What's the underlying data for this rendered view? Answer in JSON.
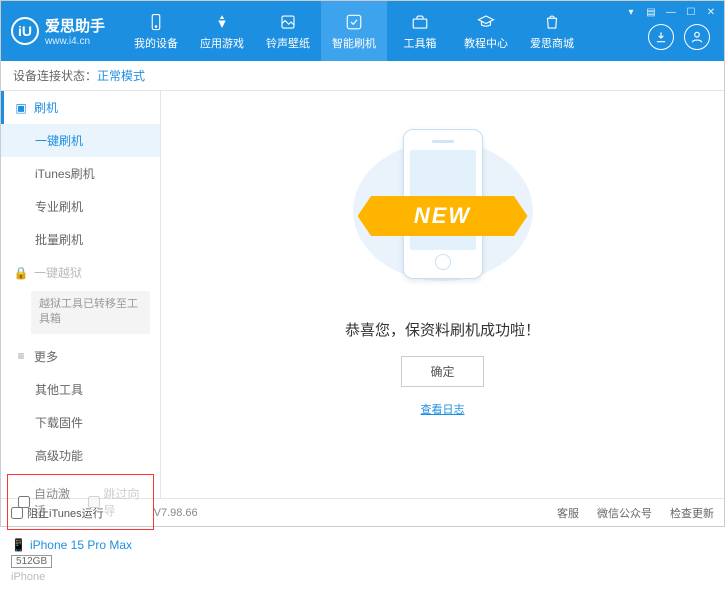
{
  "header": {
    "logoLetter": "iU",
    "title": "爱思助手",
    "subtitle": "www.i4.cn",
    "nav": [
      {
        "label": "我的设备"
      },
      {
        "label": "应用游戏"
      },
      {
        "label": "铃声壁纸"
      },
      {
        "label": "智能刷机"
      },
      {
        "label": "工具箱"
      },
      {
        "label": "教程中心"
      },
      {
        "label": "爱思商城"
      }
    ]
  },
  "status": {
    "label": "设备连接状态：",
    "value": "正常模式"
  },
  "sidebar": {
    "group1": {
      "title": "刷机"
    },
    "items1": [
      {
        "label": "一键刷机"
      },
      {
        "label": "iTunes刷机"
      },
      {
        "label": "专业刷机"
      },
      {
        "label": "批量刷机"
      }
    ],
    "groupLocked": {
      "title": "一键越狱",
      "note": "越狱工具已转移至工具箱"
    },
    "group2": {
      "title": "更多"
    },
    "items2": [
      {
        "label": "其他工具"
      },
      {
        "label": "下载固件"
      },
      {
        "label": "高级功能"
      }
    ],
    "checkboxes": {
      "auto": "自动激活",
      "skip": "跳过向导"
    },
    "device": {
      "name": "iPhone 15 Pro Max",
      "storage": "512GB",
      "type": "iPhone"
    }
  },
  "main": {
    "ribbon": "NEW",
    "successText": "恭喜您，保资料刷机成功啦！",
    "okButton": "确定",
    "viewLog": "查看日志"
  },
  "footer": {
    "blockItunes": "阻止iTunes运行",
    "version": "V7.98.66",
    "links": [
      "客服",
      "微信公众号",
      "检查更新"
    ]
  }
}
